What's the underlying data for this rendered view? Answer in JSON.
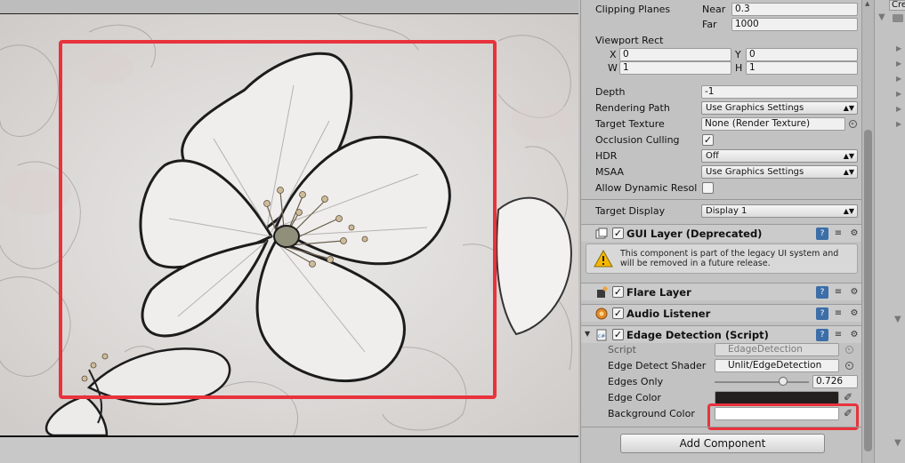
{
  "inspector": {
    "clipping_planes": {
      "label": "Clipping Planes",
      "near_label": "Near",
      "near_value": "0.3",
      "far_label": "Far",
      "far_value": "1000"
    },
    "viewport_rect": {
      "label": "Viewport Rect",
      "x_label": "X",
      "x_value": "0",
      "y_label": "Y",
      "y_value": "0",
      "w_label": "W",
      "w_value": "1",
      "h_label": "H",
      "h_value": "1"
    },
    "depth": {
      "label": "Depth",
      "value": "-1"
    },
    "rendering_path": {
      "label": "Rendering Path",
      "value": "Use Graphics Settings"
    },
    "target_texture": {
      "label": "Target Texture",
      "value": "None (Render Texture)"
    },
    "occlusion_culling": {
      "label": "Occlusion Culling",
      "checked": true
    },
    "hdr": {
      "label": "HDR",
      "value": "Off"
    },
    "msaa": {
      "label": "MSAA",
      "value": "Use Graphics Settings"
    },
    "allow_dynamic_resolution": {
      "label": "Allow Dynamic Resol",
      "checked": false
    },
    "target_display": {
      "label": "Target Display",
      "value": "Display 1"
    },
    "gui_layer": {
      "title": "GUI Layer (Deprecated)",
      "warning": "This component is part of the legacy UI system and will be removed in a future release."
    },
    "flare_layer": {
      "title": "Flare Layer"
    },
    "audio_listener": {
      "title": "Audio Listener"
    },
    "edge_detection": {
      "title": "Edage Detection (Script)",
      "script_label": "Script",
      "script_value": "EdageDetection",
      "shader_label": "Edge Detect Shader",
      "shader_value": "Unlit/EdgeDetection",
      "edges_only_label": "Edges Only",
      "edges_only_value": "0.726",
      "edges_only_fraction": 0.726,
      "edge_color_label": "Edge Color",
      "edge_color": "#231f1e",
      "background_color_label": "Background Color",
      "background_color": "#ffffff"
    },
    "add_component_label": "Add Component"
  },
  "right_panel": {
    "create_label": "Cre"
  },
  "colors": {
    "highlight": "#e8323c",
    "panel": "#c2c2c2",
    "book_icon": "#3c6ea8",
    "warning": "#f5b800"
  },
  "icons": [
    "camera-icon",
    "audio-icon",
    "script-icon",
    "warning-icon",
    "book-icon",
    "preset-icon",
    "gear-icon",
    "eyedropper-icon",
    "target-icon"
  ]
}
